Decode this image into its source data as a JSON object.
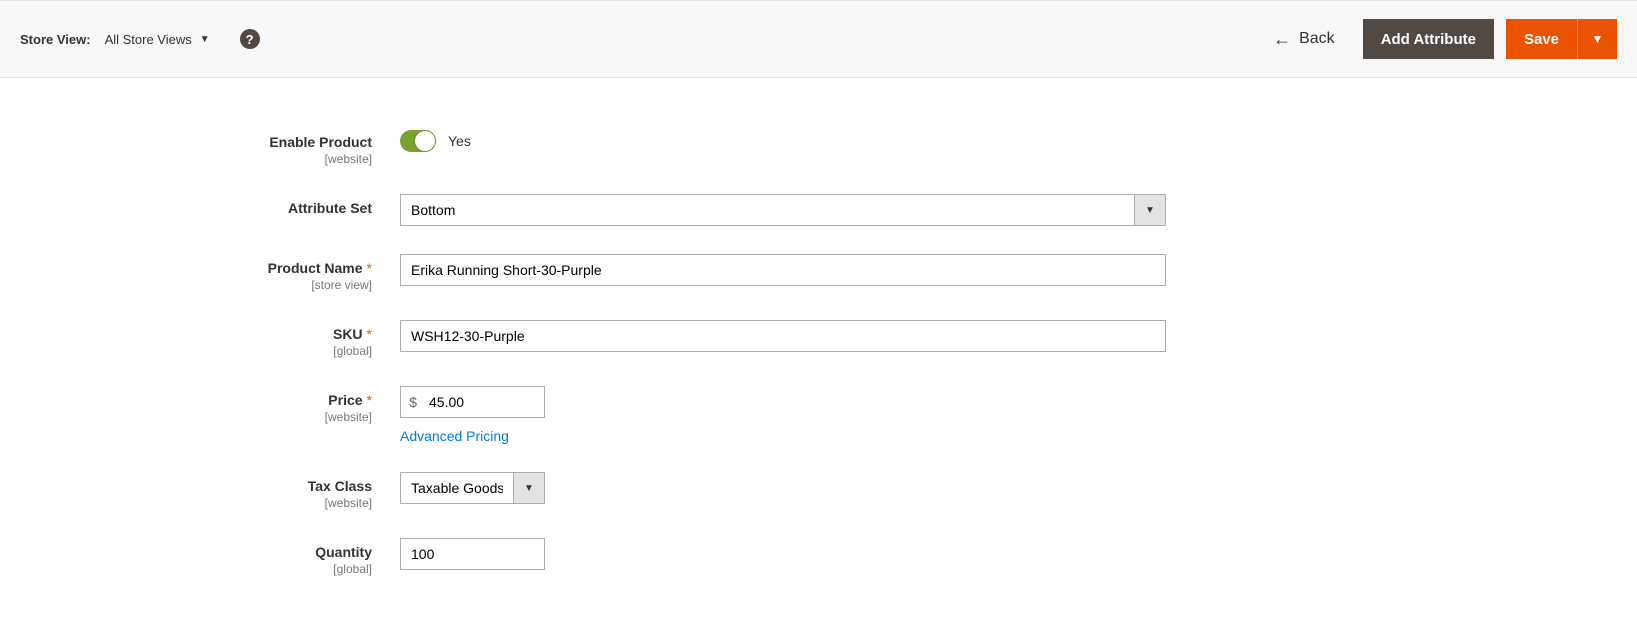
{
  "toolbar": {
    "store_view_label": "Store View:",
    "store_view_value": "All Store Views",
    "help_glyph": "?",
    "back_label": "Back",
    "add_attribute_label": "Add Attribute",
    "save_label": "Save"
  },
  "form": {
    "enable_product": {
      "label": "Enable Product",
      "scope": "[website]",
      "value_text": "Yes"
    },
    "attribute_set": {
      "label": "Attribute Set",
      "value": "Bottom"
    },
    "product_name": {
      "label": "Product Name",
      "scope": "[store view]",
      "value": "Erika Running Short-30-Purple"
    },
    "sku": {
      "label": "SKU",
      "scope": "[global]",
      "value": "WSH12-30-Purple"
    },
    "price": {
      "label": "Price",
      "scope": "[website]",
      "currency": "$",
      "value": "45.00",
      "advanced_link": "Advanced Pricing"
    },
    "tax_class": {
      "label": "Tax Class",
      "scope": "[website]",
      "value": "Taxable Goods"
    },
    "quantity": {
      "label": "Quantity",
      "scope": "[global]",
      "value": "100"
    }
  }
}
